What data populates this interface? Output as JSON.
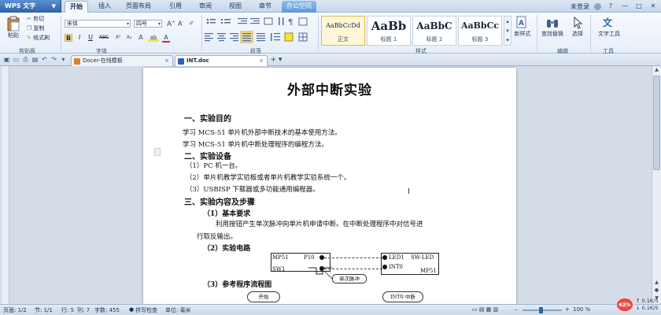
{
  "app": {
    "name": "WPS 文字",
    "dropdown_glyph": "▼"
  },
  "menu_tabs": [
    {
      "label": "开始",
      "active": true
    },
    {
      "label": "插入"
    },
    {
      "label": "页面布局"
    },
    {
      "label": "引用"
    },
    {
      "label": "审阅"
    },
    {
      "label": "视图"
    },
    {
      "label": "章节"
    },
    {
      "label": "办公空间",
      "special": true
    }
  ],
  "title_right": {
    "login": "未登录",
    "window_buttons": [
      "?",
      "—",
      "□",
      "✕"
    ]
  },
  "ribbon": {
    "clipboard": {
      "paste": "粘贴",
      "cut": "剪切",
      "copy": "复制",
      "format_painter": "格式刷",
      "group": "剪贴板"
    },
    "font": {
      "family": "宋体",
      "size": "四号",
      "group": "字体",
      "buttons": [
        "B",
        "I",
        "U",
        "ABC",
        "X²",
        "X₂",
        "A",
        "ab",
        "A"
      ]
    },
    "paragraph": {
      "group": "段落"
    },
    "styles": {
      "group": "样式",
      "items": [
        {
          "sample": "AaBbCcDd",
          "name": "正文",
          "selected": true
        },
        {
          "sample": "AaBb",
          "name": "标题 1"
        },
        {
          "sample": "AaBbC",
          "name": "标题 2"
        },
        {
          "sample": "AaBbCc",
          "name": "标题 3"
        }
      ],
      "new_style": "新样式"
    },
    "editing": {
      "find_replace": "查找替换",
      "select": "选择",
      "group": "编辑"
    },
    "tools": {
      "text_tools": "文字工具",
      "group": "工具"
    }
  },
  "doc_tabs": [
    {
      "label": "Docer-在线模板",
      "active": false,
      "icon_color": "#d9822b"
    },
    {
      "label": "INT.doc",
      "active": true,
      "icon_color": "#2f63a8"
    }
  ],
  "doc_tab_close": "×",
  "new_tab_label": "+ ▾",
  "document": {
    "title": "外部中断实验",
    "s1": "一、实验目的",
    "s1_l1": "学习 MCS-51 单片机外部中断技术的基本使用方法。",
    "s1_l2": "学习 MCS-51 单片机中断处理程序的编程方法。",
    "s2": "二、实验设备",
    "s2_l1": "（1）PC 机一台。",
    "s2_l2": "（2）单片机教学实验板或者单片机教学实验系统一个。",
    "s2_l3": "（3）USBISP 下载器或多功能通用编程器。",
    "s3": "三、实验内容及步骤",
    "s3_1": "（1）基本要求",
    "s3_1_p1": "利用按钮产生单次脉冲向单片机申请中断。在中断处理程序中对信号进",
    "s3_1_p2": "行取反输出。",
    "s3_2": "（2）实验电路",
    "s3_3": "（3）参考程序流程图",
    "circuit": {
      "mp51_left": "MP51",
      "p10": "P10",
      "sw1": "SW1",
      "led1": "LED1",
      "sw_led": "SW-LED",
      "int0": "INT0",
      "mp51_right": "MP51",
      "pulse": "单次脉冲"
    },
    "flow": {
      "start": "开始",
      "int0_isr": "INT0 中断"
    }
  },
  "status": {
    "page": "页面: 1/2",
    "section": "节: 1/1",
    "row": "行: 5",
    "col": "列: 7",
    "words": "字数: 455",
    "spell": "拼写检查",
    "unit": "单位: 毫米",
    "zoom": "100 %",
    "net_percent": "62%",
    "up": "0.1K/S",
    "down": "0.1K/S"
  }
}
